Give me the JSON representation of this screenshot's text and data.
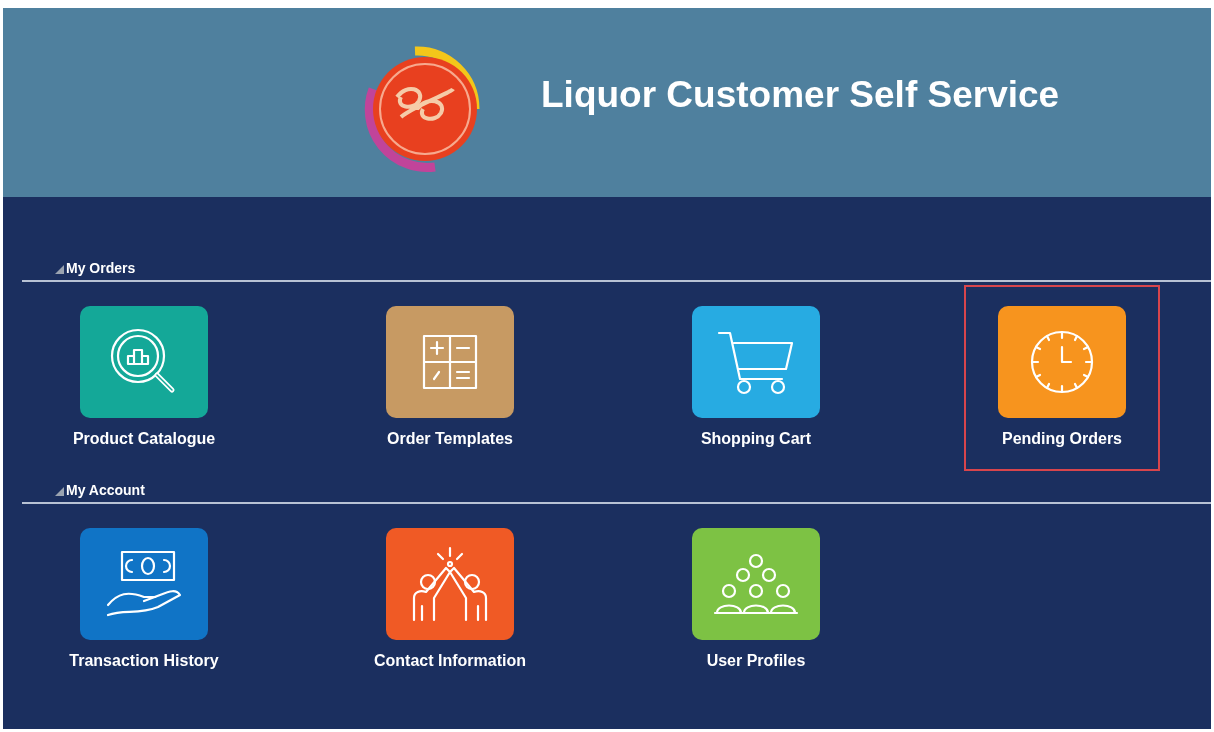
{
  "header": {
    "title": "Liquor Customer Self Service"
  },
  "sections": [
    {
      "title": "My Orders",
      "tiles": [
        {
          "label": "Product Catalogue",
          "color": "#14a898",
          "selected": false
        },
        {
          "label": "Order Templates",
          "color": "#c79a63",
          "selected": false
        },
        {
          "label": "Shopping Cart",
          "color": "#27abe2",
          "selected": false
        },
        {
          "label": "Pending Orders",
          "color": "#f7941e",
          "selected": true
        }
      ]
    },
    {
      "title": "My Account",
      "tiles": [
        {
          "label": "Transaction History",
          "color": "#1074c6",
          "selected": false
        },
        {
          "label": "Contact Information",
          "color": "#f05a25",
          "selected": false
        },
        {
          "label": "User Profiles",
          "color": "#7dc244",
          "selected": false
        }
      ]
    }
  ]
}
